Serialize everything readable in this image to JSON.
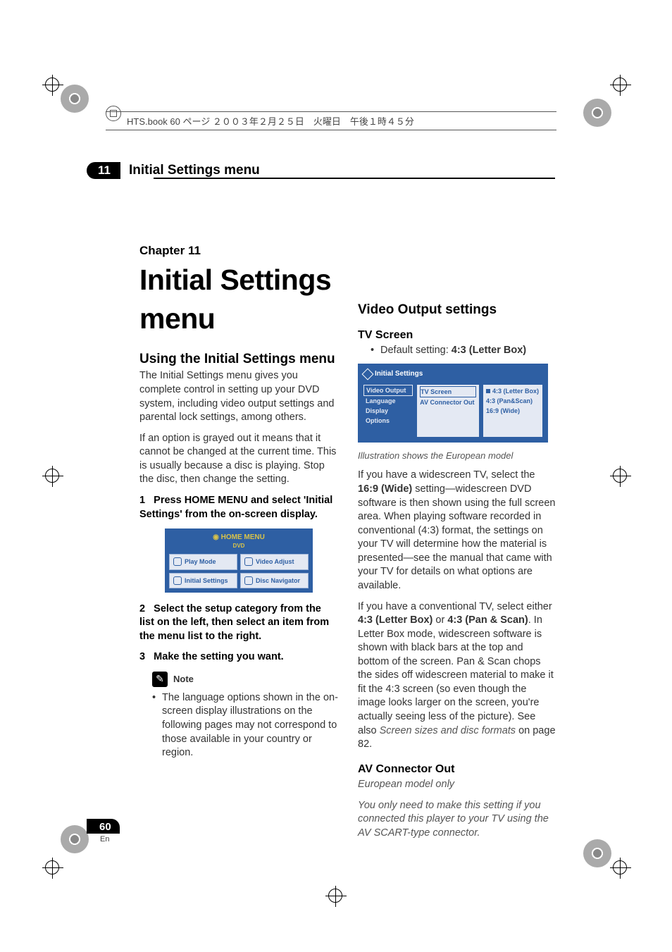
{
  "book_header": "HTS.book  60 ページ  ２００３年２月２５日　火曜日　午後１時４５分",
  "chapter_tab": {
    "number": "11",
    "title": "Initial Settings menu"
  },
  "chapter_label": "Chapter 11",
  "main_title": "Initial Settings menu",
  "left": {
    "section_title": "Using the Initial Settings menu",
    "para1": "The Initial Settings menu gives you complete control in setting up your DVD system, including video output settings and parental lock settings, among others.",
    "para2": "If an option is grayed out it means that it cannot be changed at the current time. This is usually because a disc is playing. Stop the disc, then change the setting.",
    "step1_num": "1",
    "step1_text": "Press HOME MENU and select 'Initial Settings' from the on-screen display.",
    "home_menu": {
      "title": "HOME MENU",
      "sub": "DVD",
      "cells": [
        "Play Mode",
        "Video Adjust",
        "Initial Settings",
        "Disc Navigator"
      ]
    },
    "step2_num": "2",
    "step2_text": "Select the setup category from the list on the left, then select an item from the menu list to the right.",
    "step3_num": "3",
    "step3_text": "Make the setting you want.",
    "note_label": "Note",
    "note_bullet": "The language options shown in the on-screen display illustrations on the following pages may not correspond to those available in your country or region."
  },
  "right": {
    "section_title": "Video Output settings",
    "tv_screen_heading": "TV Screen",
    "default_label": "Default setting: ",
    "default_value": "4:3 (Letter Box)",
    "settings_ui": {
      "title": "Initial Settings",
      "col1": [
        "Video Output",
        "Language",
        "Display",
        "Options"
      ],
      "col2": [
        "TV Screen",
        "AV Connector Out"
      ],
      "col3": [
        "4:3 (Letter Box)",
        "4:3 (Pan&Scan)",
        "16:9 (Wide)"
      ]
    },
    "caption": "Illustration shows the European model",
    "wide_para_a": "If you have a widescreen TV, select the ",
    "wide_bold": "16:9 (Wide)",
    "wide_para_b": " setting—widescreen DVD software is then shown using the full screen area. When playing software recorded in conventional (4:3) format, the settings on your TV will determine how the material is presented—see the manual that came with your TV for details on what options are available.",
    "conv_para_a": "If you have a conventional TV, select either ",
    "conv_bold1": "4:3 (Letter Box)",
    "conv_or": " or ",
    "conv_bold2": "4:3 (Pan & Scan)",
    "conv_para_b": ". In Letter Box mode, widescreen software is shown with black bars at the top and bottom of the screen. Pan & Scan chops the sides off widescreen material to make it fit the 4:3 screen (so even though the image looks larger on the screen, you're actually seeing less of the picture). See also ",
    "conv_ref": "Screen sizes and disc formats",
    "conv_page": " on page 82.",
    "av_heading": "AV Connector Out",
    "av_italic1": "European model only",
    "av_italic2": "You only need to make this setting if you connected this player to your TV using the AV SCART-type connector."
  },
  "page_number": "60",
  "page_lang": "En"
}
